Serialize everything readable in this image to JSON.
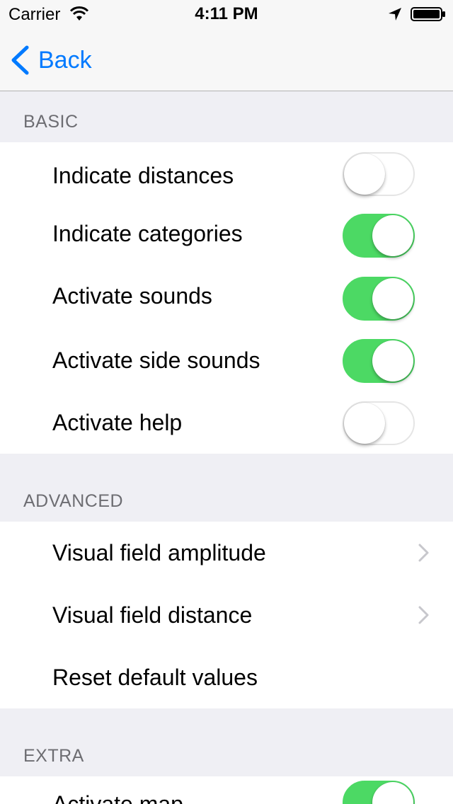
{
  "status_bar": {
    "carrier": "Carrier",
    "time": "4:11 PM"
  },
  "nav": {
    "back_label": "Back"
  },
  "colors": {
    "accent": "#007aff",
    "switch_on": "#4cd964",
    "section_text": "#6d6d72"
  },
  "sections": {
    "basic": {
      "header": "BASIC",
      "rows": [
        {
          "label": "Indicate distances",
          "switch_on": false
        },
        {
          "label": "Indicate categories",
          "switch_on": true
        },
        {
          "label": "Activate sounds",
          "switch_on": true
        },
        {
          "label": "Activate side sounds",
          "switch_on": true
        },
        {
          "label": "Activate help",
          "switch_on": false
        }
      ]
    },
    "advanced": {
      "header": "ADVANCED",
      "rows": [
        {
          "label": "Visual field amplitude",
          "accessory": "chevron-right-icon"
        },
        {
          "label": "Visual field distance",
          "accessory": "chevron-right-icon"
        },
        {
          "label": "Reset default values"
        }
      ]
    },
    "extra": {
      "header": "EXTRA",
      "rows": [
        {
          "label": "Activate map",
          "switch_on": true
        }
      ]
    }
  }
}
